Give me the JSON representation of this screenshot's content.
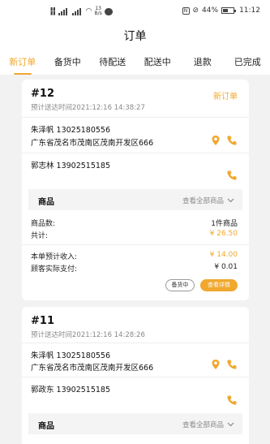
{
  "statusbar": {
    "net_speed": "13",
    "net_unit": "B/s",
    "battery": "44%",
    "time": "11:12"
  },
  "header": {
    "title": "订单"
  },
  "tabs": [
    {
      "label": "新订单",
      "active": true
    },
    {
      "label": "备货中",
      "active": false
    },
    {
      "label": "待配送",
      "active": false
    },
    {
      "label": "配送中",
      "active": false
    },
    {
      "label": "退款",
      "active": false
    },
    {
      "label": "已完成",
      "active": false
    }
  ],
  "orders": [
    {
      "number": "#12",
      "status": "新订单",
      "deadline": "预计送达时间2021:12:16 14:38:27",
      "customer": "朱泽帆 13025180556",
      "address": "广东省茂名市茂南区茂南开发区666",
      "rider": "郭志林 13902515185",
      "goods_title": "商品",
      "goods_all": "查看全部商品",
      "item_count_label": "商品数:",
      "item_count_value": "1件商品",
      "total_label": "共计:",
      "total_value": "¥ 26.50",
      "income_label": "本单预计收入:",
      "income_value": "¥ 14.00",
      "paid_label": "顾客实际支付:",
      "paid_value": "¥ 0.01",
      "btn_stock": "备货中",
      "btn_detail": "查看详情"
    },
    {
      "number": "#11",
      "deadline": "预计送达时间2021:12:16 14:28:26",
      "customer": "朱泽帆 13025180556",
      "address": "广东省茂名市茂南区茂南开发区666",
      "rider": "郭政东 13902515185",
      "goods_title": "商品",
      "goods_all": "查看全部商品"
    }
  ],
  "colors": {
    "accent": "#f0a82e",
    "background": "#f2f2f2"
  },
  "icons": [
    "location-pin-icon",
    "phone-icon",
    "chevron-down-icon"
  ]
}
